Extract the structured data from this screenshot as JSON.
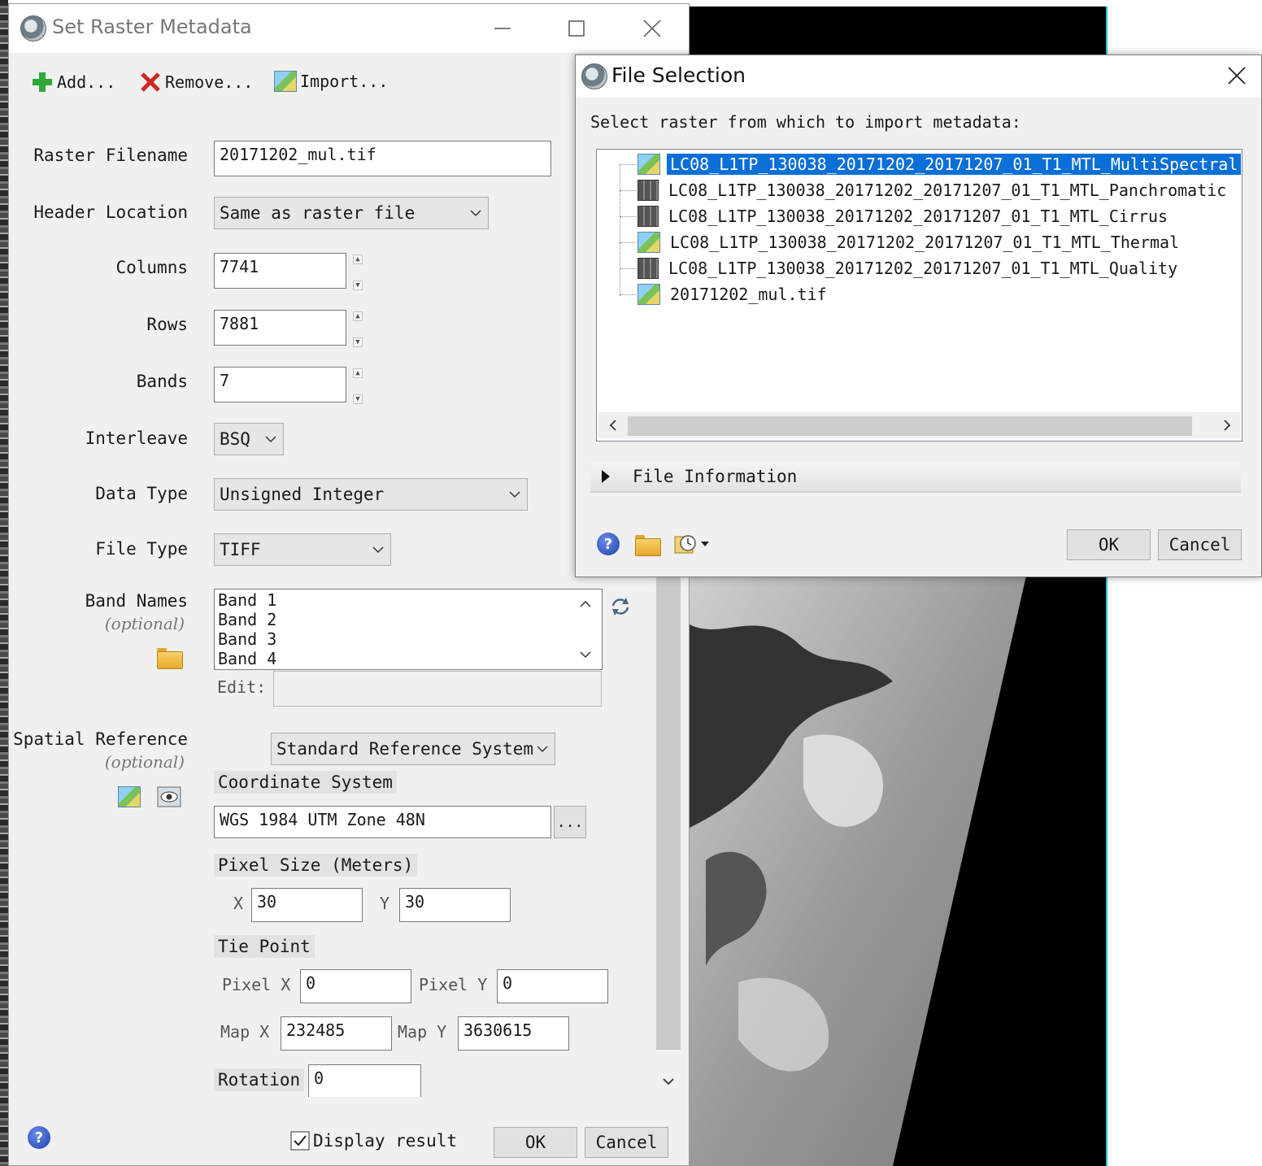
{
  "srm": {
    "title": "Set Raster Metadata",
    "toolbar": {
      "add": "Add...",
      "remove": "Remove...",
      "import": "Import..."
    },
    "labels": {
      "raster_filename": "Raster Filename",
      "header_location": "Header Location",
      "columns": "Columns",
      "rows": "Rows",
      "bands": "Bands",
      "interleave": "Interleave",
      "data_type": "Data Type",
      "file_type": "File Type",
      "band_names": "Band Names",
      "optional": "(optional)",
      "edit": "Edit:",
      "spatial_reference": "Spatial Reference",
      "coordinate_system": "Coordinate System",
      "pixel_size": "Pixel Size (Meters)",
      "x": "X",
      "y": "Y",
      "tie_point": "Tie Point",
      "pixel_x": "Pixel X",
      "pixel_y": "Pixel Y",
      "map_x": "Map X",
      "map_y": "Map Y",
      "rotation": "Rotation"
    },
    "values": {
      "raster_filename": "20171202_mul.tif",
      "header_location": "Same as raster file",
      "columns": "7741",
      "rows": "7881",
      "bands": "7",
      "interleave": "BSQ",
      "data_type": "Unsigned Integer",
      "file_type": "TIFF",
      "band_names": [
        "Band 1",
        "Band 2",
        "Band 3",
        "Band 4"
      ],
      "spatial_reference_mode": "Standard Reference System",
      "coordinate_system": "WGS 1984 UTM Zone 48N",
      "browse": "...",
      "pixel_size_x": "30",
      "pixel_size_y": "30",
      "pixel_x": "0",
      "pixel_y": "0",
      "map_x": "232485",
      "map_y": "3630615",
      "rotation": "0"
    },
    "footer": {
      "display_result": "Display result",
      "display_result_checked": true,
      "ok": "OK",
      "cancel": "Cancel"
    }
  },
  "file_selection": {
    "title": "File Selection",
    "prompt": "Select raster from which to import metadata:",
    "items": [
      {
        "name": "LC08_L1TP_130038_20171202_20171207_01_T1_MTL_MultiSpectral",
        "icon": "color-raster-icon",
        "selected": true
      },
      {
        "name": "LC08_L1TP_130038_20171202_20171207_01_T1_MTL_Panchromatic",
        "icon": "gray-raster-icon",
        "selected": false
      },
      {
        "name": "LC08_L1TP_130038_20171202_20171207_01_T1_MTL_Cirrus",
        "icon": "gray-raster-icon",
        "selected": false
      },
      {
        "name": "LC08_L1TP_130038_20171202_20171207_01_T1_MTL_Thermal",
        "icon": "color-raster-icon",
        "selected": false
      },
      {
        "name": "LC08_L1TP_130038_20171202_20171207_01_T1_MTL_Quality",
        "icon": "gray-raster-icon",
        "selected": false
      },
      {
        "name": "20171202_mul.tif",
        "icon": "color-raster-icon",
        "selected": false
      }
    ],
    "file_information": "File Information",
    "ok": "OK",
    "cancel": "Cancel"
  },
  "colors": {
    "selection": "#0a6fd6",
    "dialog_bg": "#f0f0f0",
    "image_border": "#22c6d6"
  }
}
